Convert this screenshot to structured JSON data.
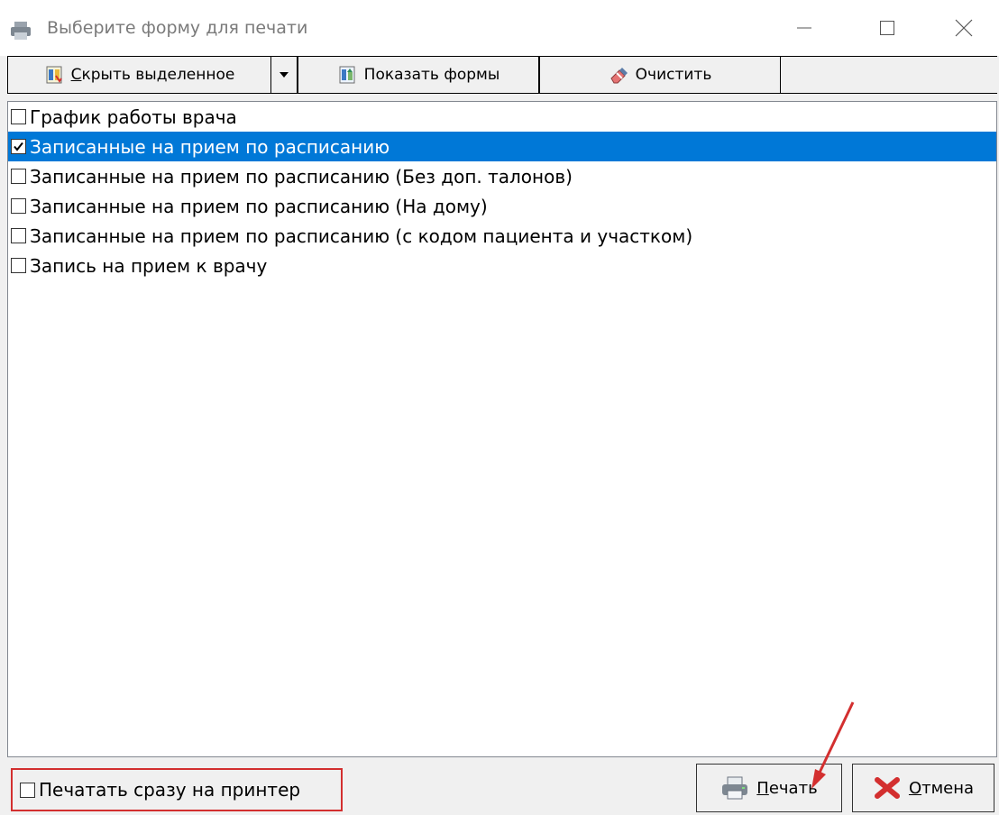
{
  "window": {
    "title": "Выберите форму для печати",
    "icon": "printer-icon",
    "controls": [
      "minimize",
      "maximize",
      "close"
    ]
  },
  "toolbar": {
    "hide_selected_label": "Скрыть выделенное",
    "show_forms_label": "Показать формы",
    "clear_label": "Очистить"
  },
  "list": {
    "items": [
      {
        "label": "График работы врача",
        "checked": false,
        "selected": false
      },
      {
        "label": "Записанные на прием по расписанию",
        "checked": true,
        "selected": true
      },
      {
        "label": "Записанные на прием по расписанию (Без доп. талонов)",
        "checked": false,
        "selected": false
      },
      {
        "label": "Записанные на прием по расписанию (На дому)",
        "checked": false,
        "selected": false
      },
      {
        "label": "Записанные на прием по расписанию (с кодом пациента и участком)",
        "checked": false,
        "selected": false
      },
      {
        "label": "Запись на прием к врачу",
        "checked": false,
        "selected": false
      }
    ]
  },
  "footer": {
    "print_direct_label": "Печатать сразу на принтер",
    "print_direct_checked": false,
    "print_label": "Печать",
    "cancel_label": "Отмена"
  },
  "colors": {
    "selection": "#0078d7",
    "highlight_frame": "#d32f2f",
    "annotation_arrow": "#d32f2f"
  }
}
